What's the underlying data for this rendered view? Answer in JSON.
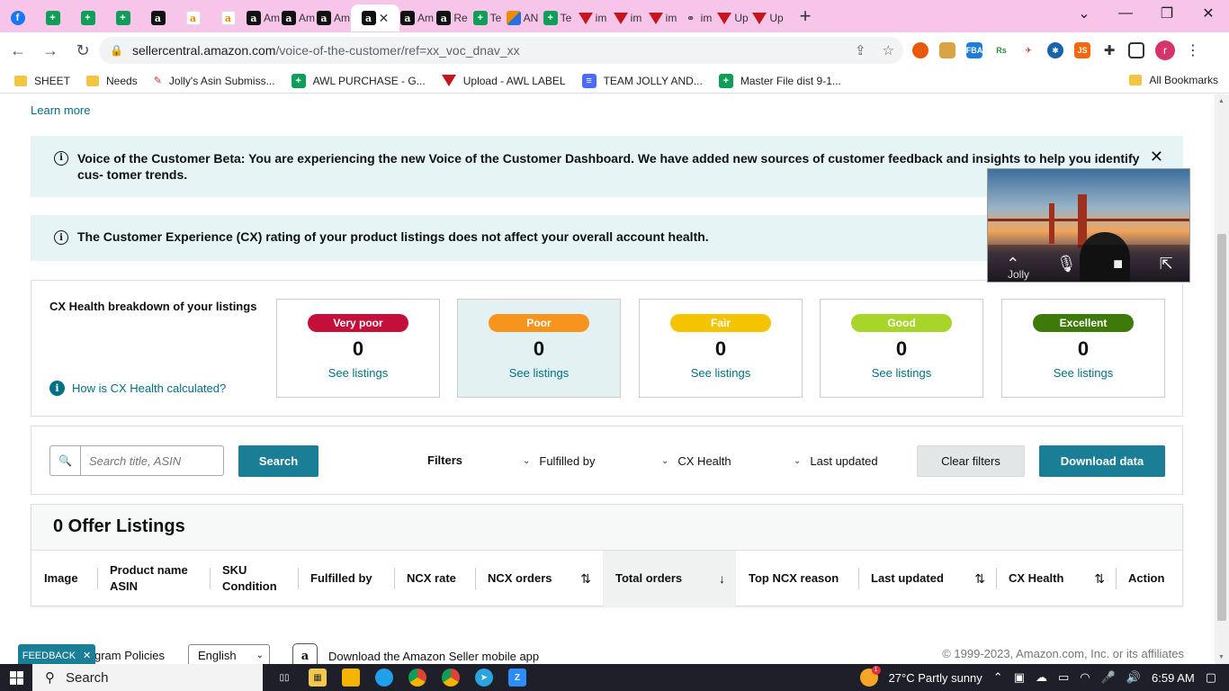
{
  "browser": {
    "tabs": [
      {
        "icon": "facebook-icon",
        "label": ""
      },
      {
        "icon": "sheets-icon",
        "label": ""
      },
      {
        "icon": "sheets-icon",
        "label": ""
      },
      {
        "icon": "sheets-icon",
        "label": ""
      },
      {
        "icon": "amazon-icon",
        "label": ""
      },
      {
        "icon": "amazon-smile-icon",
        "label": ""
      },
      {
        "icon": "amazon-smile-icon",
        "label": ""
      },
      {
        "icon": "amazon-icon",
        "label": "Am"
      },
      {
        "icon": "amazon-icon",
        "label": "Am"
      },
      {
        "icon": "amazon-icon",
        "label": "Am"
      },
      {
        "icon": "amazon-icon",
        "label": ""
      },
      {
        "icon": "amazon-icon",
        "label": "Am"
      },
      {
        "icon": "amazon-icon",
        "label": "Re"
      },
      {
        "icon": "sheets-icon",
        "label": "Te"
      },
      {
        "icon": "pen-icon",
        "label": "AN"
      },
      {
        "icon": "sheets-icon",
        "label": "Te"
      },
      {
        "icon": "label-icon",
        "label": "im"
      },
      {
        "icon": "label-icon",
        "label": "im"
      },
      {
        "icon": "label-icon",
        "label": "im"
      },
      {
        "icon": "link-icon",
        "label": "im"
      },
      {
        "icon": "label-icon",
        "label": "Up"
      },
      {
        "icon": "label-icon",
        "label": "Up"
      }
    ],
    "url_host": "sellercentral.amazon.com",
    "url_path": "/voice-of-the-customer/ref=xx_voc_dnav_xx",
    "profile_initial": "r",
    "bookmarks": [
      {
        "icon": "folder-icon",
        "label": "SHEET"
      },
      {
        "icon": "folder-icon",
        "label": "Needs"
      },
      {
        "icon": "asin-icon",
        "label": "Jolly's Asin Submiss..."
      },
      {
        "icon": "sheets-icon",
        "label": "AWL PURCHASE - G..."
      },
      {
        "icon": "label-icon",
        "label": "Upload - AWL LABEL"
      },
      {
        "icon": "docs-icon",
        "label": "TEAM JOLLY AND..."
      },
      {
        "icon": "sheets-icon",
        "label": "Master File dist 9-1..."
      }
    ],
    "all_bookmarks": "All Bookmarks"
  },
  "page": {
    "learn_more": "Learn more",
    "beta_alert": "Voice of the Customer Beta: You are experiencing the new Voice of the Customer Dashboard. We have added new sources of customer feedback and insights to help you identify cus- tomer trends.",
    "cx_alert": "The Customer Experience (CX) rating of your product listings does not affect your overall account health.",
    "cx_breakdown_title": "CX Health breakdown of your listings",
    "cx_help_link": "How is CX Health calculated?",
    "cx_categories": [
      {
        "label": "Very poor",
        "count": "0",
        "link": "See listings",
        "color": "#c40f3a"
      },
      {
        "label": "Poor",
        "count": "0",
        "link": "See listings",
        "color": "#f7941d"
      },
      {
        "label": "Fair",
        "count": "0",
        "link": "See listings",
        "color": "#f5c400"
      },
      {
        "label": "Good",
        "count": "0",
        "link": "See listings",
        "color": "#a7d52a"
      },
      {
        "label": "Excellent",
        "count": "0",
        "link": "See listings",
        "color": "#3d7a0a"
      }
    ],
    "search_placeholder": "Search title, ASIN",
    "search_button": "Search",
    "filters_label": "Filters",
    "filter_fulfilled_by": "Fulfilled by",
    "filter_cx_health": "CX Health",
    "filter_last_updated": "Last updated",
    "clear_filters": "Clear filters",
    "download_data": "Download data",
    "listings_heading": "0 Offer Listings",
    "table_headers": {
      "image": "Image",
      "product_name": "Product name",
      "asin": "ASIN",
      "sku": "SKU",
      "condition": "Condition",
      "fulfilled_by": "Fulfilled by",
      "ncx_rate": "NCX rate",
      "ncx_orders": "NCX orders",
      "total_orders": "Total orders",
      "top_ncx_reason": "Top NCX reason",
      "last_updated": "Last updated",
      "cx_health": "CX Health",
      "action": "Action"
    },
    "feedback": "FEEDBACK",
    "program_policies": "gram Policies",
    "language": "English",
    "app_download": "Download the Amazon Seller mobile app",
    "copyright": "© 1999-2023, Amazon.com, Inc. or its affiliates"
  },
  "video": {
    "participant": "Jolly"
  },
  "taskbar": {
    "search_label": "Search",
    "weather": "27°C  Partly sunny",
    "time": "6:59 AM",
    "weather_badge": "1"
  },
  "colors": {
    "teal": "#1a7e96",
    "link": "#007185",
    "alert_bg": "#e7f4f5",
    "tab_strip": "#f7c5ea"
  }
}
